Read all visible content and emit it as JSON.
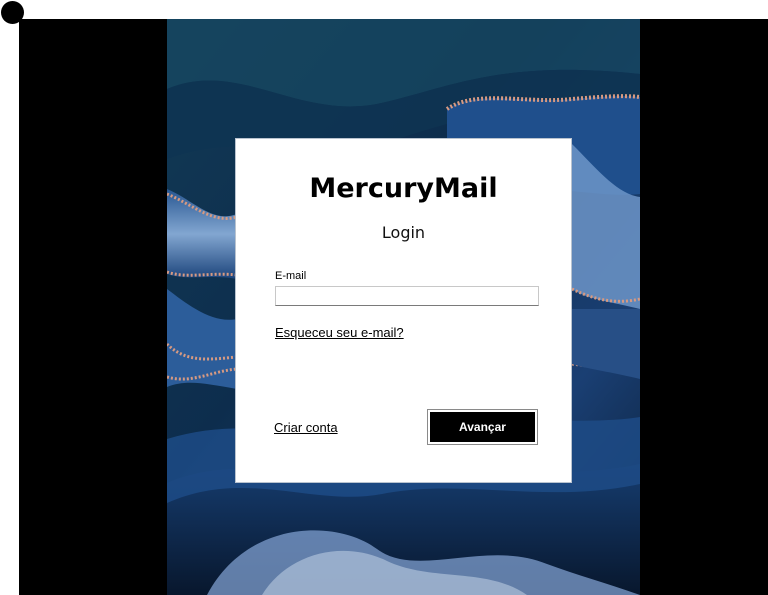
{
  "app": {
    "brand": "MercuryMail",
    "screen_title": "Login"
  },
  "form": {
    "email_label": "E-mail",
    "email_value": "",
    "email_placeholder": "",
    "forgot_link": "Esqueceu seu e-mail?",
    "create_account_link": "Criar conta",
    "next_button": "Avançar"
  },
  "theme": {
    "frame": "#000000",
    "card_background": "#ffffff",
    "button_background": "#000000",
    "button_text": "#ffffff",
    "wallpaper_primary": "#0b2a4a",
    "wallpaper_accent": "#d79a82"
  },
  "icons": {
    "corner_indicator": "black-dot-icon"
  }
}
